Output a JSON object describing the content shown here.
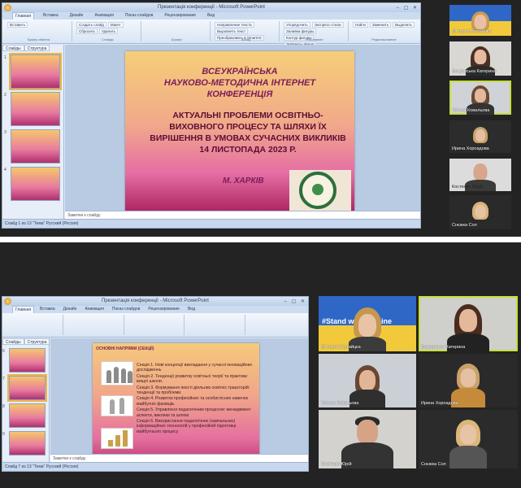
{
  "top": {
    "window_title": "Презентація конференції - Microsoft PowerPoint",
    "ribbon_tabs": [
      "Главная",
      "Вставка",
      "Дизайн",
      "Анимация",
      "Показ слайдов",
      "Рецензирование",
      "Вид"
    ],
    "ribbon_buttons": [
      "Вставить",
      "Создать слайд",
      "Макет",
      "Сбросить",
      "Удалить",
      "Направление текста",
      "Выровнять текст",
      "Преобразовать в SmartArt",
      "Упорядочить",
      "Экспресс-стили",
      "Заливка фигуры",
      "Контур фигуры",
      "Эффекты фигур",
      "Найти",
      "Заменить",
      "Выделить"
    ],
    "ribbon_groups": [
      "Буфер обмена",
      "Слайды",
      "Шрифт",
      "Абзац",
      "Рисование",
      "Редактирование"
    ],
    "panel_tabs": [
      "Слайды",
      "Структура"
    ],
    "thumb_numbers": [
      "1",
      "2",
      "3",
      "4"
    ],
    "notes_placeholder": "Заметки к слайду",
    "status": "Слайд 1 из 13    \"Тема\"    Русский (Россия)",
    "slide": {
      "heading_lines": [
        "ВСЕУКРАЇНСЬКА",
        "НАУКОВО-МЕТОДИЧНА ІНТЕРНЕТ",
        "КОНФЕРЕНЦІЯ"
      ],
      "title_lines": [
        "АКТУАЛЬНІ ПРОБЛЕМИ ОСВІТНЬО-",
        "ВИХОВНОГО ПРОЦЕСУ  ТА ШЛЯХИ ЇХ",
        "ВИРІШЕННЯ В УМОВАХ СУЧАСНИХ ВИКЛИКІВ",
        "14 ЛИСТОПАДА 2023 Р."
      ],
      "city": "М. ХАРКІВ"
    },
    "participants": [
      {
        "name": "Вікторія Вертайцка"
      },
      {
        "name": "Богдорська Катерина"
      },
      {
        "name": "Тетяна Ковальова"
      },
      {
        "name": "Ирина Хороадова"
      },
      {
        "name": "Костенко Юрій"
      },
      {
        "name": "Снєжка Сол"
      }
    ]
  },
  "bottom": {
    "window_title": "Презентація конференції - Microsoft PowerPoint",
    "ribbon_tabs": [
      "Главная",
      "Вставка",
      "Дизайн",
      "Анимация",
      "Показ слайдов",
      "Рецензирование",
      "Вид"
    ],
    "panel_tabs": [
      "Слайды",
      "Структура"
    ],
    "thumb_numbers": [
      "6",
      "7",
      "8",
      "9"
    ],
    "notes_placeholder": "Заметки к слайду",
    "status": "Слайд 7 из 13    \"Тема\"    Русский (Россия)",
    "slide": {
      "heading": "ОСНОВНІ НАПРЯМИ (СЕКЦІЇ)",
      "sections": [
        "Секція 1. Нові концепції викладання у сучасні інноваційних дослідженнь",
        "Секція 2. Тенденції розвитку освітньої теорії та практики вищої школи.",
        "Секція 3. Формування якості діяльних освітніх траєкторій: тенденції та проблеми.",
        "Секція 4. Розвиток професійних та особистісних навичок майбутніх фахівців.",
        "Секція 5. Управління педагогічним процесом: менеджмент аспекти, виклики та шляхи",
        "Секція 6. Використання педагогічних (навчальних) інформаційних технологій у професійній підготовці майбутнього процесу"
      ]
    },
    "participants": [
      {
        "name": "Вікторія Вертайцка",
        "banner": "#Stand with Ukraine"
      },
      {
        "name": "Богдорська Катерина"
      },
      {
        "name": "Тетяна Ковальова"
      },
      {
        "name": "Ирина Хороадова"
      },
      {
        "name": "Костенко Юрій"
      },
      {
        "name": "Снєжка Сол"
      }
    ]
  }
}
